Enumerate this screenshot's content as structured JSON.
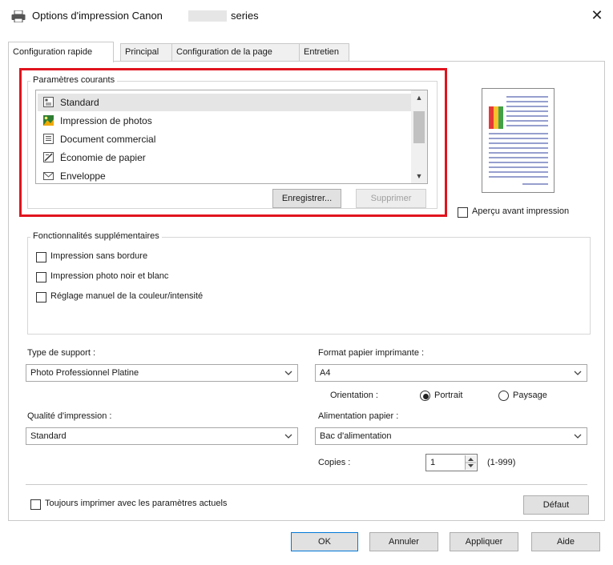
{
  "window": {
    "title": "Options d'impression Canon",
    "title_suffix": "series",
    "close_glyph": "✕"
  },
  "tabs": [
    {
      "label": "Configuration rapide",
      "active": true
    },
    {
      "label": "Principal",
      "active": false
    },
    {
      "label": "Configuration de la page",
      "active": false
    },
    {
      "label": "Entretien",
      "active": false
    }
  ],
  "current_settings": {
    "group_label": "Paramètres courants",
    "items": [
      {
        "label": "Standard",
        "icon": "standard-doc-icon",
        "selected": true
      },
      {
        "label": "Impression de photos",
        "icon": "photo-icon",
        "selected": false
      },
      {
        "label": "Document commercial",
        "icon": "business-doc-icon",
        "selected": false
      },
      {
        "label": "Économie de papier",
        "icon": "paper-saving-icon",
        "selected": false
      },
      {
        "label": "Enveloppe",
        "icon": "envelope-icon",
        "selected": false
      }
    ],
    "save_button": "Enregistrer...",
    "delete_button": "Supprimer"
  },
  "preview": {
    "label": "Aperçu avant impression",
    "checked": false
  },
  "additional_features": {
    "group_label": "Fonctionnalités supplémentaires",
    "options": [
      {
        "label": "Impression sans bordure",
        "checked": false
      },
      {
        "label": "Impression photo noir et blanc",
        "checked": false
      },
      {
        "label": "Réglage manuel de la couleur/intensité",
        "checked": false
      }
    ]
  },
  "media_type": {
    "label": "Type de support :",
    "value": "Photo Professionnel Platine"
  },
  "paper_size": {
    "label": "Format papier imprimante :",
    "value": "A4"
  },
  "orientation": {
    "label": "Orientation :",
    "portrait": "Portrait",
    "landscape": "Paysage",
    "selected": "Portrait"
  },
  "print_quality": {
    "label": "Qualité d'impression :",
    "value": "Standard"
  },
  "paper_source": {
    "label": "Alimentation papier :",
    "value": "Bac d'alimentation"
  },
  "copies": {
    "label": "Copies :",
    "value": "1",
    "range": "(1-999)"
  },
  "always_print": {
    "label": "Toujours imprimer avec les paramètres actuels",
    "checked": false
  },
  "buttons": {
    "default": "Défaut",
    "ok": "OK",
    "cancel": "Annuler",
    "apply": "Appliquer",
    "help": "Aide"
  },
  "colors": {
    "highlight_box": "#e0141e",
    "focus_border": "#0078d7"
  }
}
